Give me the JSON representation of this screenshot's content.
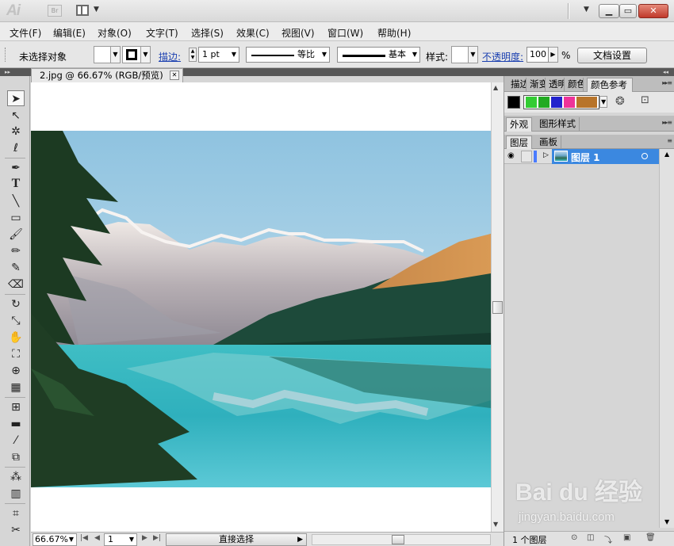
{
  "app": {
    "logo": "Ai",
    "bridge": "Br"
  },
  "menu": [
    "文件(F)",
    "编辑(E)",
    "对象(O)",
    "文字(T)",
    "选择(S)",
    "效果(C)",
    "视图(V)",
    "窗口(W)",
    "帮助(H)"
  ],
  "control": {
    "selection_status": "未选择对象",
    "stroke_label": "描边:",
    "stroke_weight": "1 pt",
    "profile_label": "等比",
    "brush_label": "基本",
    "style_label": "样式:",
    "opacity_label": "不透明度:",
    "opacity_value": "100",
    "opacity_unit": "%",
    "doc_setup": "文档设置"
  },
  "document": {
    "tab_title": "2.jpg @ 66.67% (RGB/预览)",
    "zoom": "66.67%",
    "page": "1",
    "tool_status": "直接选择"
  },
  "panels": {
    "top_tabs": [
      "描边",
      "渐变",
      "透明",
      "颜色",
      "颜色参考"
    ],
    "guide_colors": [
      "#000000",
      "#33cc33",
      "#22aa22",
      "#2222cc",
      "#ee3399",
      "#b8742a"
    ],
    "mid_tabs": [
      "外观",
      "图形样式"
    ],
    "layer_tabs": [
      "图层",
      "画板"
    ],
    "layer_name": "图层 1",
    "layer_count": "1 个图层"
  },
  "watermark": {
    "logo": "Bai du 经验",
    "url": "jingyan.baidu.com"
  }
}
